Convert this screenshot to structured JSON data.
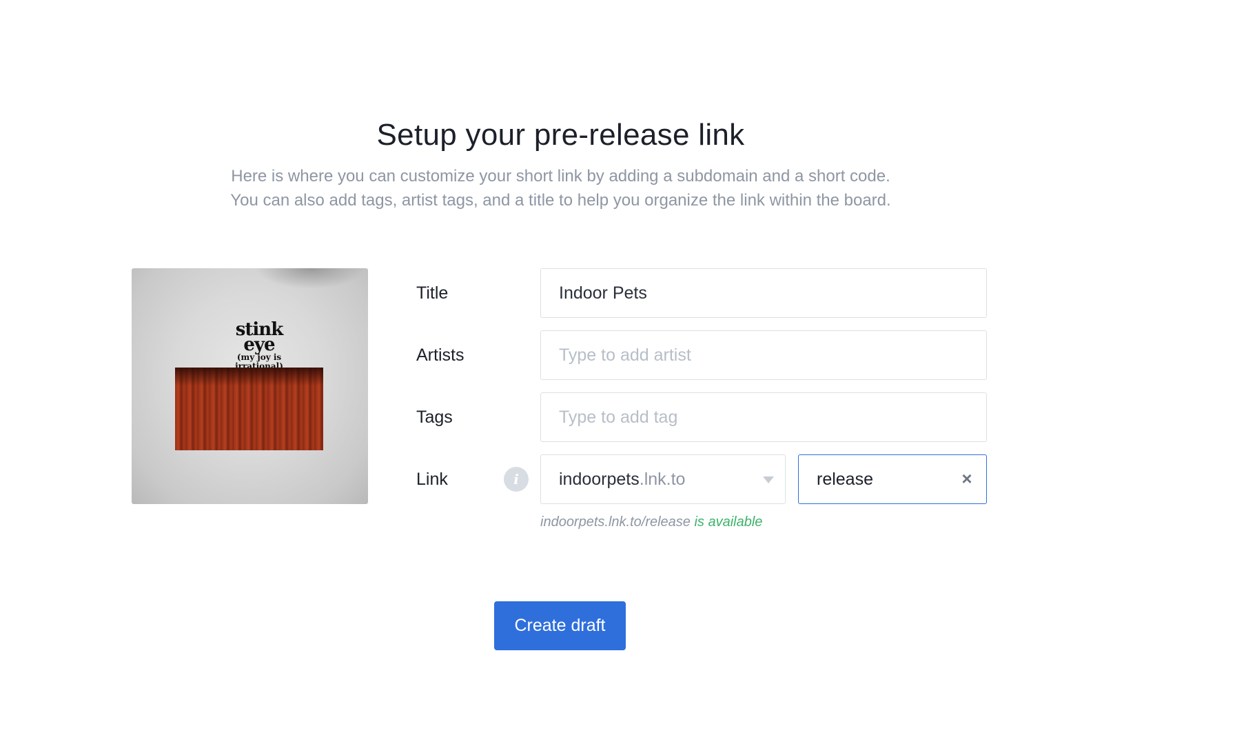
{
  "page": {
    "title": "Setup your pre-release link",
    "subtitle_line1": "Here is where you can customize your short link by adding a subdomain and a short code.",
    "subtitle_line2": "You can also add tags, artist tags, and a title to help you organize the link within the board."
  },
  "cover": {
    "title_top": "stink",
    "title_bottom": "eye",
    "subtitle_top": "(my joy is",
    "subtitle_bottom": "irrational)"
  },
  "form": {
    "title": {
      "label": "Title",
      "value": "Indoor Pets"
    },
    "artists": {
      "label": "Artists",
      "placeholder": "Type to add artist"
    },
    "tags": {
      "label": "Tags",
      "placeholder": "Type to add tag"
    },
    "link": {
      "label": "Link",
      "info_glyph": "i",
      "subdomain": "indoorpets",
      "domain_suffix": ".lnk.to",
      "code": "release",
      "clear_glyph": "×",
      "preview_url": "indoorpets.lnk.to/release",
      "availability_text": "is available"
    }
  },
  "colors": {
    "accent": "#2f6fdc",
    "available": "#3db36b",
    "muted_text": "#8e96a3"
  },
  "actions": {
    "create_label": "Create draft"
  }
}
